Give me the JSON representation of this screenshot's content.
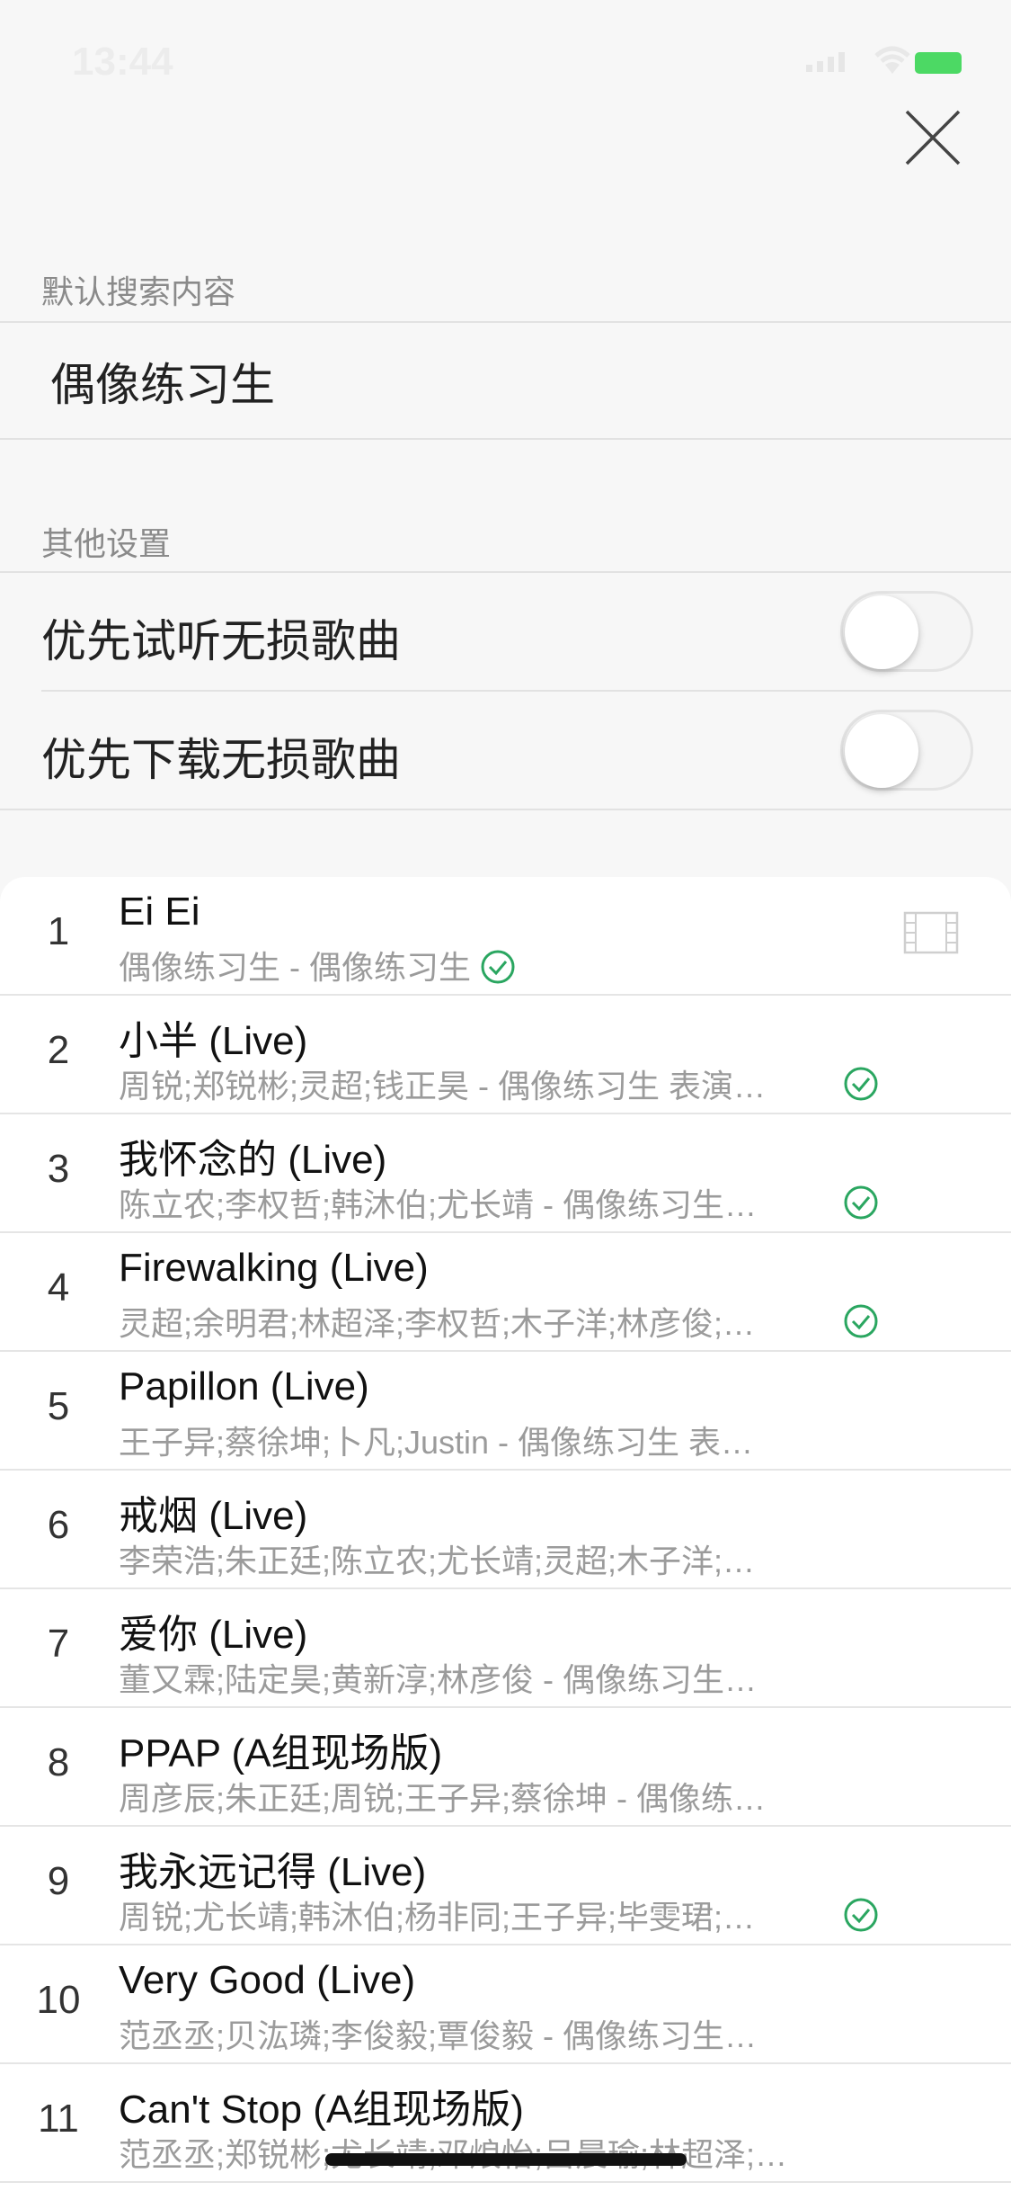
{
  "status": {
    "time": "13:44"
  },
  "default_search": {
    "section_label": "默认搜索内容",
    "value": "偶像练习生"
  },
  "other_settings": {
    "section_label": "其他设置",
    "items": [
      {
        "label": "优先试听无损歌曲",
        "enabled": false
      },
      {
        "label": "优先下载无损歌曲",
        "enabled": false
      }
    ]
  },
  "songs": [
    {
      "num": "1",
      "title": "Ei Ei",
      "subtitle": "偶像练习生 - 偶像练习生",
      "downloaded": true,
      "has_mv": true
    },
    {
      "num": "2",
      "title": "小半 (Live)",
      "subtitle": "周锐;郑锐彬;灵超;钱正昊 - 偶像练习生 表演…",
      "downloaded": true,
      "has_mv": false
    },
    {
      "num": "3",
      "title": "我怀念的 (Live)",
      "subtitle": "陈立农;李权哲;韩沐伯;尤长靖 - 偶像练习生…",
      "downloaded": true,
      "has_mv": false
    },
    {
      "num": "4",
      "title": "Firewalking (Live)",
      "subtitle": "灵超;余明君;林超泽;李权哲;木子洋;林彦俊;…",
      "downloaded": true,
      "has_mv": false
    },
    {
      "num": "5",
      "title": "Papillon (Live)",
      "subtitle": "王子异;蔡徐坤;卜凡;Justin - 偶像练习生 表…",
      "downloaded": false,
      "has_mv": false
    },
    {
      "num": "6",
      "title": "戒烟 (Live)",
      "subtitle": "李荣浩;朱正廷;陈立农;尤长靖;灵超;木子洋;…",
      "downloaded": false,
      "has_mv": false
    },
    {
      "num": "7",
      "title": "爱你 (Live)",
      "subtitle": "董又霖;陆定昊;黄新淳;林彦俊 - 偶像练习生…",
      "downloaded": false,
      "has_mv": false
    },
    {
      "num": "8",
      "title": "PPAP (A组现场版)",
      "subtitle": "周彦辰;朱正廷;周锐;王子异;蔡徐坤 - 偶像练…",
      "downloaded": false,
      "has_mv": false
    },
    {
      "num": "9",
      "title": "我永远记得 (Live)",
      "subtitle": "周锐;尤长靖;韩沐伯;杨非同;王子异;毕雯珺;…",
      "downloaded": true,
      "has_mv": false
    },
    {
      "num": "10",
      "title": "Very Good (Live)",
      "subtitle": "范丞丞;贝汯璘;李俊毅;覃俊毅 - 偶像练习生…",
      "downloaded": false,
      "has_mv": false
    },
    {
      "num": "11",
      "title": "Can't Stop (A组现场版)",
      "subtitle": "范丞丞;郑锐彬;尤长靖;邓烺怡;吕晨瑜;林超泽;…",
      "downloaded": false,
      "has_mv": false
    }
  ],
  "colors": {
    "accent_green": "#2aa660",
    "battery": "#4cd964"
  },
  "icons": {
    "close": "close-icon",
    "check": "check-circle-icon",
    "mv": "mv-film-icon"
  }
}
